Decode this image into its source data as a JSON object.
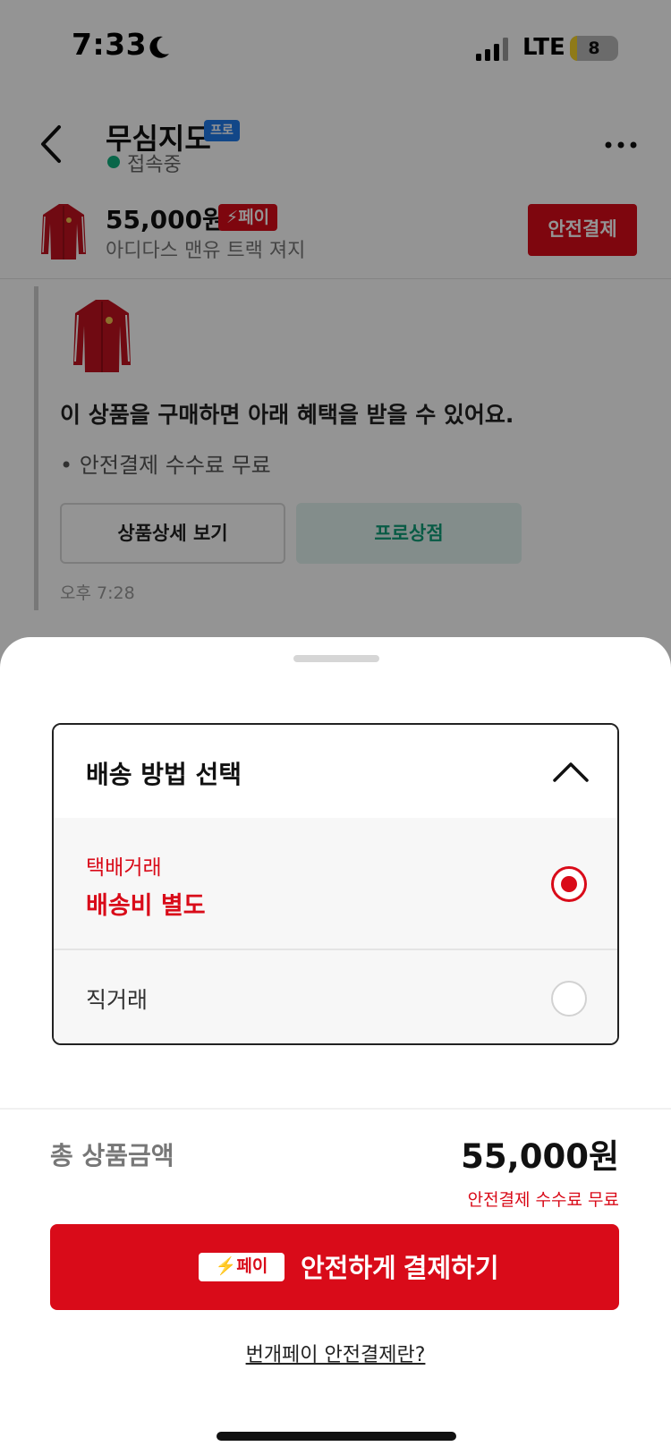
{
  "status_bar": {
    "time": "7:33",
    "network": "LTE",
    "battery": "8"
  },
  "chat_header": {
    "seller_name": "무심지도",
    "seller_badge": "프로",
    "presence": "접속중"
  },
  "product_bar": {
    "price": "55,000원",
    "pay_badge": "페이",
    "title": "아디다스 맨유 트랙 져지",
    "safe_pay_button": "안전결제"
  },
  "message": {
    "headline": "이 상품을 구매하면 아래 혜택을 받을 수 있어요.",
    "benefit": "• 안전결제 수수료 무료",
    "detail_button": "상품상세 보기",
    "store_button": "프로상점",
    "time": "오후 7:28"
  },
  "sheet": {
    "delivery_title": "배송 방법 선택",
    "options": [
      {
        "label": "택배거래",
        "sub": "배송비 별도",
        "selected": true
      },
      {
        "label": "직거래",
        "selected": false
      }
    ],
    "total_label": "총 상품금액",
    "total_price": "55,000원",
    "fee_note": "안전결제 수수료 무료",
    "pay_badge": "페이",
    "pay_button": "안전하게 결제하기",
    "learn_link": "번개페이 안전결제란?"
  },
  "colors": {
    "accent_red": "#d90b19",
    "pro_blue": "#1f7bea",
    "online_green": "#10b07e"
  },
  "icons": [
    "moon-icon",
    "signal-icon",
    "battery-icon",
    "back-icon",
    "more-icon",
    "chevron-up-icon",
    "lightning-icon",
    "radio-selected-icon",
    "radio-empty-icon"
  ]
}
